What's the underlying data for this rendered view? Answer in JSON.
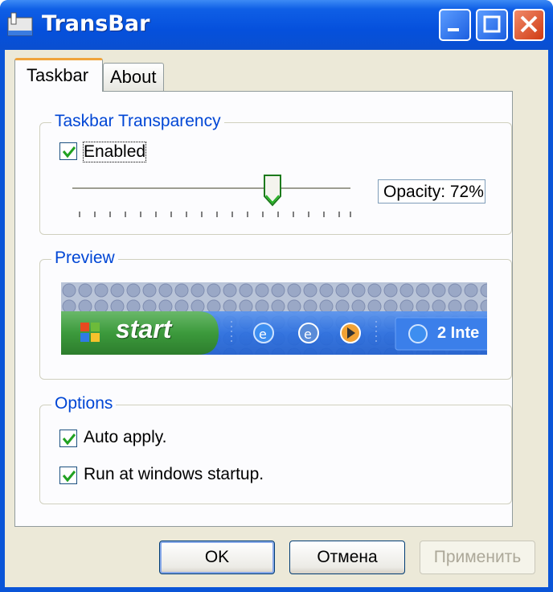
{
  "window": {
    "title": "TransBar"
  },
  "tabs": [
    {
      "label": "Taskbar",
      "selected": true
    },
    {
      "label": "About",
      "selected": false
    }
  ],
  "transparency": {
    "group_label": "Taskbar Transparency",
    "enabled_label": "Enabled",
    "enabled_checked": true,
    "opacity_text": "Opacity: 72%",
    "opacity_value": 0.72
  },
  "preview": {
    "group_label": "Preview",
    "start_label": "start",
    "task_label": "2 Inte"
  },
  "options": {
    "group_label": "Options",
    "items": [
      {
        "label": "Auto apply.",
        "checked": true
      },
      {
        "label": "Run at windows startup.",
        "checked": true
      }
    ]
  },
  "buttons": {
    "ok": "OK",
    "cancel": "Отмена",
    "apply": "Применить"
  },
  "colors": {
    "title_bar": "#0550dc",
    "group_label": "#0046d5",
    "checkmark": "#21a121",
    "close_button": "#d03b13",
    "taskbar_green": "#3c9a3c",
    "taskbar_blue": "#2b6fe0"
  }
}
